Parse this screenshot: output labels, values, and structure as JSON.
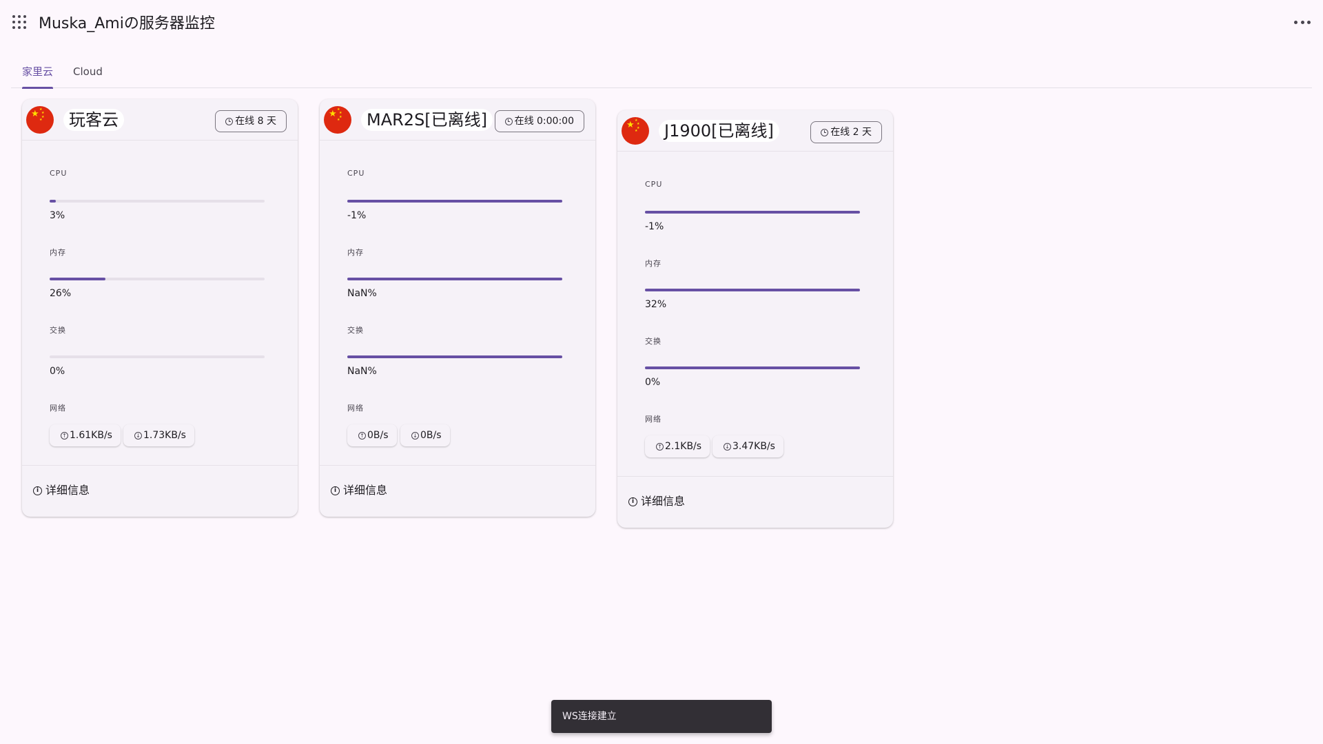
{
  "app": {
    "title": "Muska_Amiの服务器监控"
  },
  "tabs": [
    {
      "label": "家里云",
      "active": true
    },
    {
      "label": "Cloud",
      "active": false
    }
  ],
  "labels": {
    "cpu": "CPU",
    "memory": "内存",
    "swap": "交换",
    "network": "网络",
    "details": "详细信息"
  },
  "servers": [
    {
      "name": "玩客云",
      "uptime": "在线  8 天",
      "country_flag": "china-flag-icon",
      "cpu": "3%",
      "cpu_level": 0.03,
      "memory": "26%",
      "memory_level": 0.26,
      "swap": "0%",
      "swap_level": 0.0,
      "net_up": "1.61KB/s",
      "net_down": "1.73KB/s"
    },
    {
      "name": "MAR2S[已离线]",
      "uptime": "在线  0:00:00",
      "country_flag": "china-flag-icon",
      "cpu": "-1%",
      "cpu_level": 1.0,
      "memory": "NaN%",
      "memory_level": 1.0,
      "swap": "NaN%",
      "swap_level": 1.0,
      "net_up": "0B/s",
      "net_down": "0B/s"
    },
    {
      "name": "J1900[已离线]",
      "uptime": "在线  2 天",
      "country_flag": "china-flag-icon",
      "cpu": "-1%",
      "cpu_level": 1.0,
      "memory": "32%",
      "memory_level": 1.0,
      "swap": "0%",
      "swap_level": 1.0,
      "net_up": "2.1KB/s",
      "net_down": "3.47KB/s"
    }
  ],
  "snackbar": {
    "message": "WS连接建立"
  },
  "colors": {
    "accent": "#6750a4",
    "background": "#fdf7fd",
    "card": "#f6f2f8",
    "snackbar": "#322f35"
  }
}
